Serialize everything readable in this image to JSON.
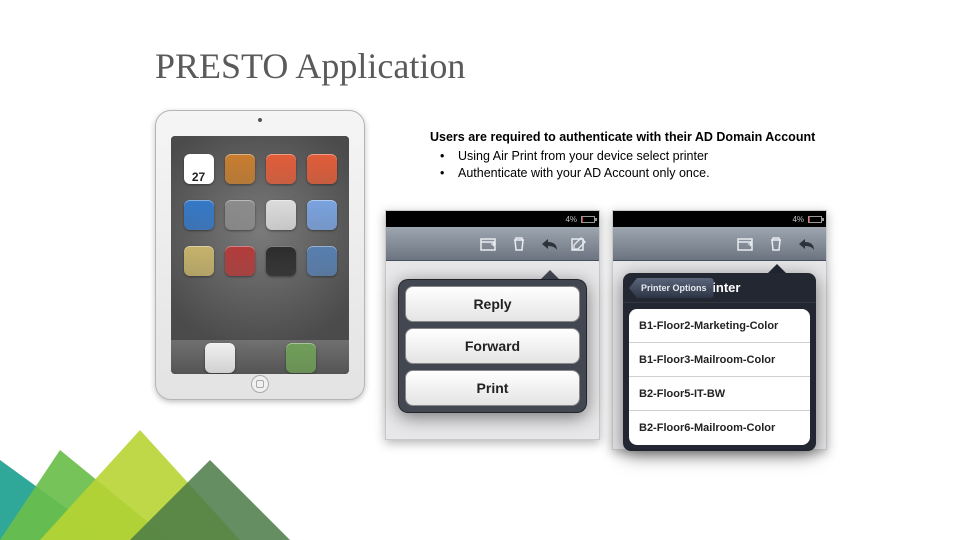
{
  "title": "PRESTO Application",
  "description": {
    "lead": "Users are required to authenticate with their AD Domain Account",
    "bullets": [
      "Using Air Print from your device select printer",
      "Authenticate with your AD Account only once."
    ]
  },
  "ipad": {
    "calendar_day": "27",
    "app_colors": [
      "#f3f3f3",
      "#c97e2e",
      "#e25d39",
      "#e25d39",
      "#3478c8",
      "#8c8c8c",
      "#dcdcdc",
      "#7aa3e0",
      "#c6b36a",
      "#b33a3a",
      "#2c2c2c",
      "#587fb0",
      "#efefef",
      "#6f9e57"
    ]
  },
  "phones": {
    "battery_pct": "4%",
    "left": {
      "actions": [
        "Reply",
        "Forward",
        "Print"
      ],
      "nav_icons": [
        "folder-move-icon",
        "trash-icon",
        "reply-icon",
        "compose-icon"
      ]
    },
    "right": {
      "nav_icons": [
        "folder-move-icon",
        "trash-icon",
        "reply-icon"
      ],
      "back_label": "Printer Options",
      "popover_title": "Printer",
      "printers": [
        "B1-Floor2-Marketing-Color",
        "B1-Floor3-Mailroom-Color",
        "B2-Floor5-IT-BW",
        "B2-Floor6-Mailroom-Color"
      ]
    }
  }
}
